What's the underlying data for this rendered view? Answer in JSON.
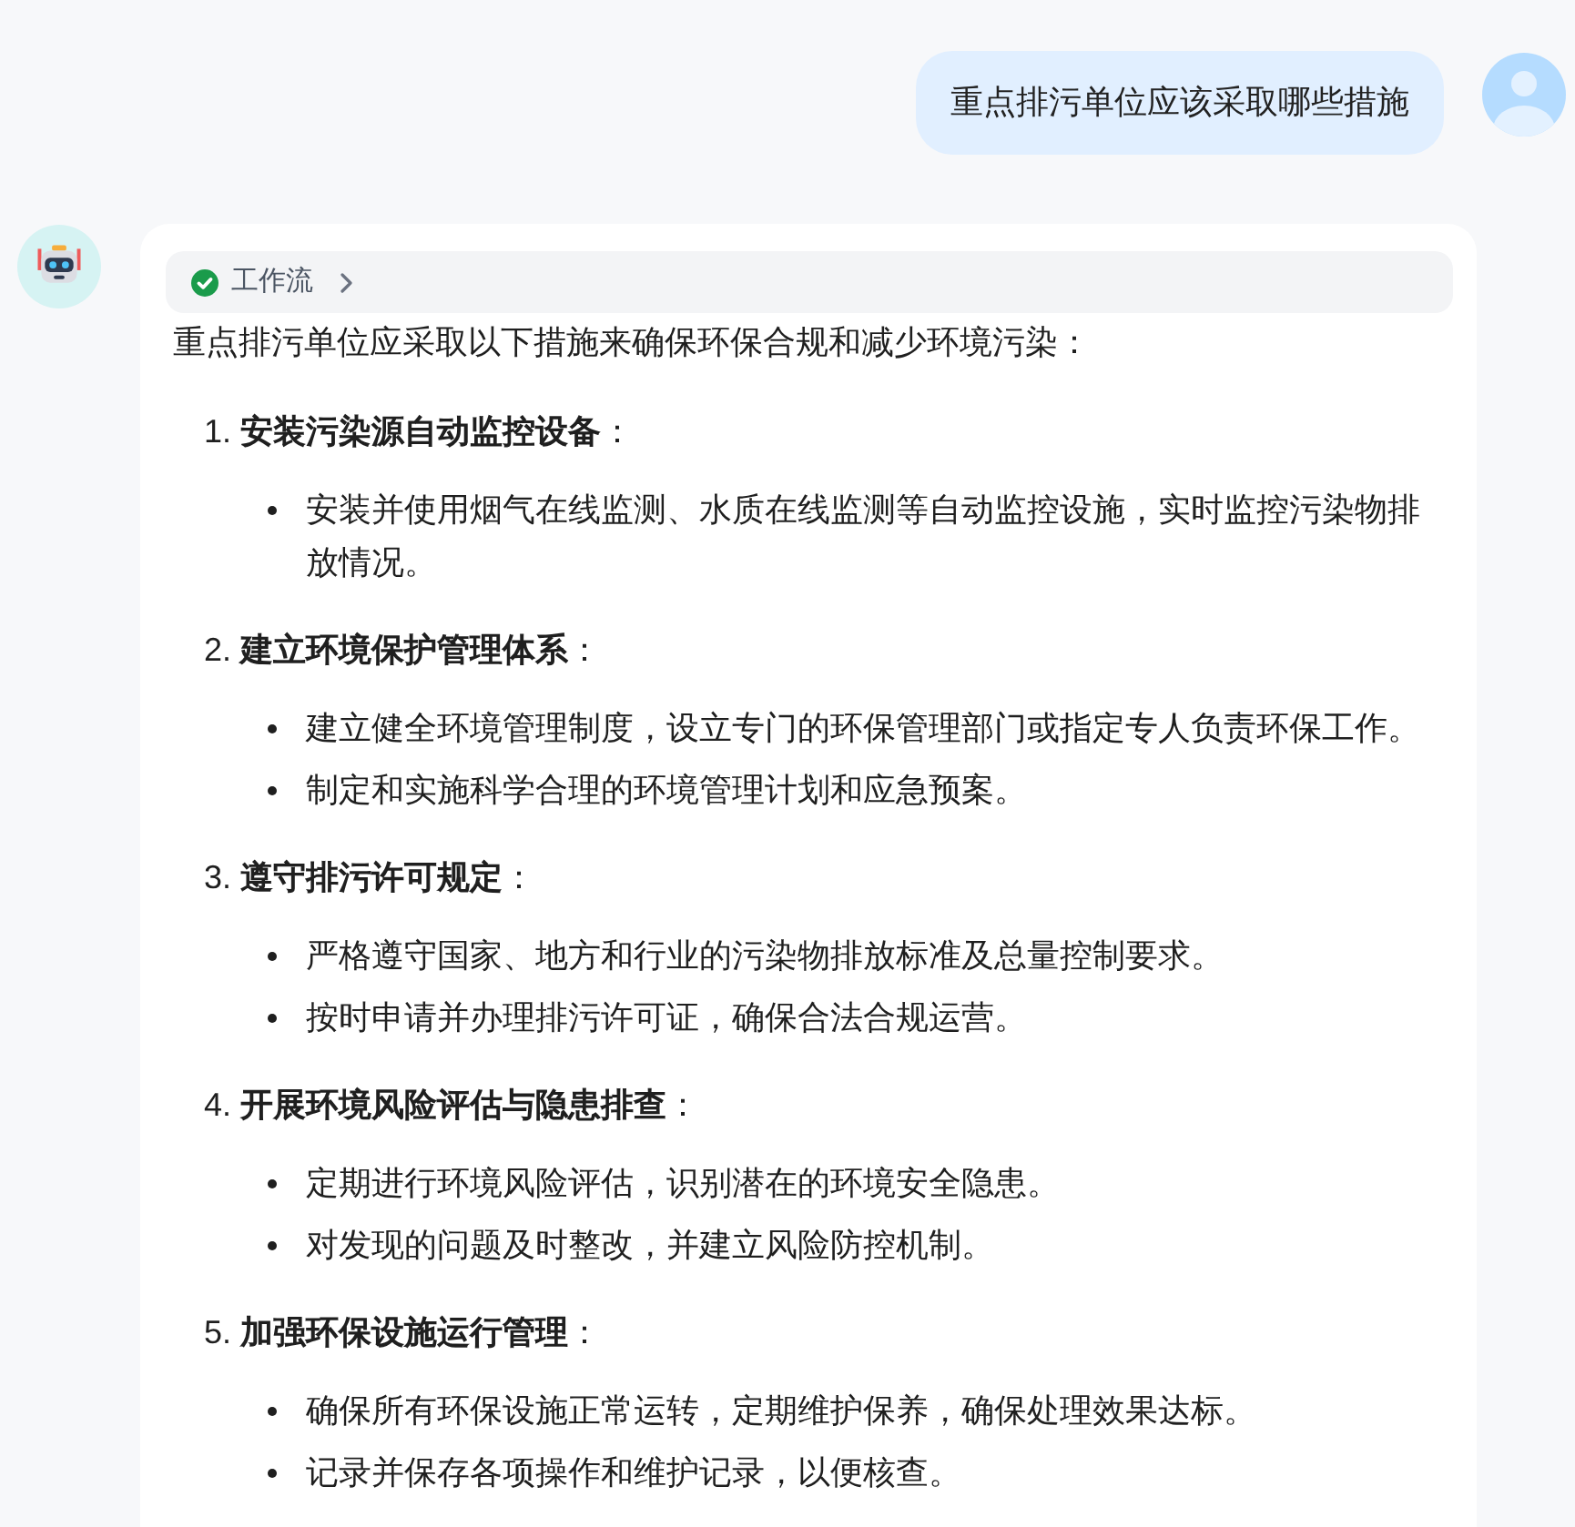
{
  "user_message": {
    "text": "重点排污单位应该采取哪些措施"
  },
  "assistant_message": {
    "workflow": {
      "label": "工作流",
      "completed": true
    },
    "intro": "重点排污单位应采取以下措施来确保环保合规和减少环境污染：",
    "sections": [
      {
        "heading": "1. **安装污染源自动监控设备**：",
        "bullets": [
          "安装并使用烟气在线监测、水质在线监测等自动监控设施，实时监控污染物排放情况。"
        ]
      },
      {
        "heading": "2. **建立环境保护管理体系**：",
        "bullets": [
          "建立健全环境管理制度，设立专门的环保管理部门或指定专人负责环保工作。",
          "制定和实施科学合理的环境管理计划和应急预案。"
        ]
      },
      {
        "heading": "3. **遵守排污许可规定**：",
        "bullets": [
          "严格遵守国家、地方和行业的污染物排放标准及总量控制要求。",
          "按时申请并办理排污许可证，确保合法合规运营。"
        ]
      },
      {
        "heading": "4. **开展环境风险评估与隐患排查**：",
        "bullets": [
          "定期进行环境风险评估，识别潜在的环境安全隐患。",
          "对发现的问题及时整改，并建立风险防控机制。"
        ]
      },
      {
        "heading": "5. **加强环保设施运行管理**：",
        "bullets": [
          "确保所有环保设施正常运转，定期维护保养，确保处理效果达标。",
          "记录并保存各项操作和维护记录，以便核查。"
        ]
      }
    ]
  }
}
